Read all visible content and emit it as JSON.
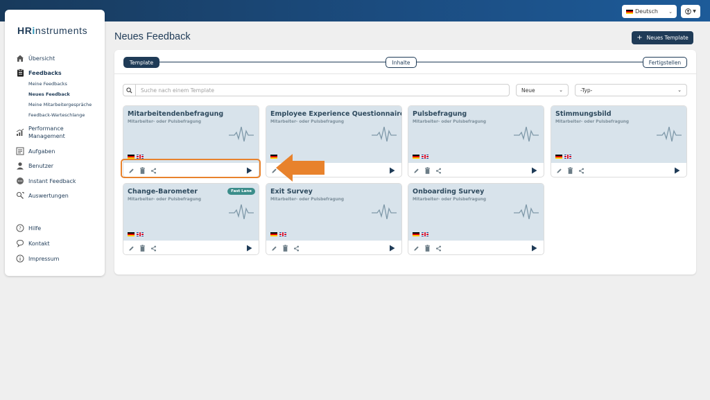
{
  "topbar": {
    "language": "Deutsch"
  },
  "logo": {
    "part1": "HR",
    "part2": "i",
    "part3": "nstruments"
  },
  "sidebar": {
    "items": [
      {
        "label": "Übersicht",
        "icon": "home-icon"
      },
      {
        "label": "Feedbacks",
        "icon": "clipboard-icon"
      },
      {
        "label": "Performance Management",
        "icon": "chart-icon"
      },
      {
        "label": "Aufgaben",
        "icon": "tasks-icon"
      },
      {
        "label": "Benutzer",
        "icon": "user-icon"
      },
      {
        "label": "Instant Feedback",
        "icon": "chat-icon"
      },
      {
        "label": "Auswertungen",
        "icon": "analytics-icon"
      }
    ],
    "subitems": [
      "Meine Feedbacks",
      "Neues Feedback",
      "Meine Mitarbeitergespräche",
      "Feedback-Warteschlange"
    ],
    "footer": [
      {
        "label": "Hilfe",
        "icon": "help-icon"
      },
      {
        "label": "Kontakt",
        "icon": "contact-icon"
      },
      {
        "label": "Impressum",
        "icon": "info-icon"
      }
    ]
  },
  "page": {
    "title": "Neues Feedback",
    "new_template_label": "Neues Template"
  },
  "steps": [
    "Template",
    "Inhalte",
    "Fertigstellen"
  ],
  "filters": {
    "search_placeholder": "Suche nach einem Template",
    "sort": "Neue",
    "type": "-Typ-"
  },
  "cards": [
    {
      "title": "Mitarbeitendenbefragung",
      "subtitle": "Mitarbeiter- oder Pulsbefragung",
      "badge": ""
    },
    {
      "title": "Employee Experience Questionnaire",
      "subtitle": "Mitarbeiter- oder Pulsbefragung",
      "badge": ""
    },
    {
      "title": "Pulsbefragung",
      "subtitle": "Mitarbeiter- oder Pulsbefragung",
      "badge": ""
    },
    {
      "title": "Stimmungsbild",
      "subtitle": "Mitarbeiter- oder Pulsbefragung",
      "badge": ""
    },
    {
      "title": "Change-Barometer",
      "subtitle": "Mitarbeiter- oder Pulsbefragung",
      "badge": "Fast Lane"
    },
    {
      "title": "Exit Survey",
      "subtitle": "Mitarbeiter- oder Pulsbefragung",
      "badge": ""
    },
    {
      "title": "Onboarding Survey",
      "subtitle": "Mitarbeiter- oder Pulsbefragung",
      "badge": ""
    }
  ],
  "colors": {
    "primary": "#1f3b57",
    "card_bg": "#d8e3eb",
    "highlight": "#e8822c",
    "badge": "#3b8d8a"
  }
}
